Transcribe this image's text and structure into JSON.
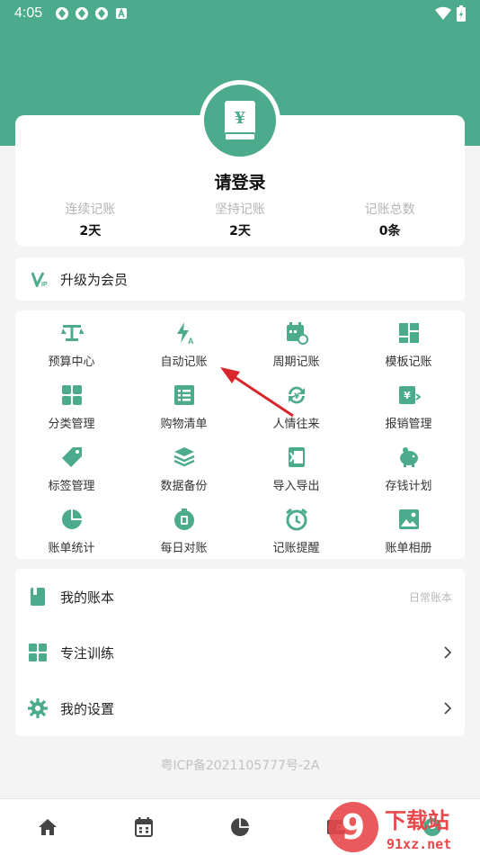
{
  "status": {
    "time": "4:05"
  },
  "profile": {
    "login_text": "请登录",
    "stats": [
      {
        "label": "连续记账",
        "value": "2天"
      },
      {
        "label": "坚持记账",
        "value": "2天"
      },
      {
        "label": "记账总数",
        "value": "0条"
      }
    ]
  },
  "vip": {
    "label": "升级为会员"
  },
  "grid": [
    {
      "label": "预算中心",
      "icon": "scale-icon"
    },
    {
      "label": "自动记账",
      "icon": "flash-auto-icon"
    },
    {
      "label": "周期记账",
      "icon": "calendar-refresh-icon"
    },
    {
      "label": "模板记账",
      "icon": "template-icon"
    },
    {
      "label": "分类管理",
      "icon": "grid-icon"
    },
    {
      "label": "购物清单",
      "icon": "list-icon"
    },
    {
      "label": "人情往来",
      "icon": "exchange-icon"
    },
    {
      "label": "报销管理",
      "icon": "reimburse-icon"
    },
    {
      "label": "标签管理",
      "icon": "tag-icon"
    },
    {
      "label": "数据备份",
      "icon": "layers-icon"
    },
    {
      "label": "导入导出",
      "icon": "excel-icon"
    },
    {
      "label": "存钱计划",
      "icon": "piggy-icon"
    },
    {
      "label": "账单统计",
      "icon": "pie-icon"
    },
    {
      "label": "每日对账",
      "icon": "daily-icon"
    },
    {
      "label": "记账提醒",
      "icon": "alarm-icon"
    },
    {
      "label": "账单相册",
      "icon": "photo-icon"
    }
  ],
  "list": {
    "my_books": {
      "label": "我的账本",
      "value": "日常账本"
    },
    "focus": {
      "label": "专注训练"
    },
    "settings": {
      "label": "我的设置"
    }
  },
  "icp": "粤ICP备2021105777号-2A",
  "watermark": {
    "brand": "下载站",
    "domain": "91xz.net",
    "num": "9"
  },
  "colors": {
    "accent": "#4caa8d",
    "arrow": "#d9262c"
  }
}
